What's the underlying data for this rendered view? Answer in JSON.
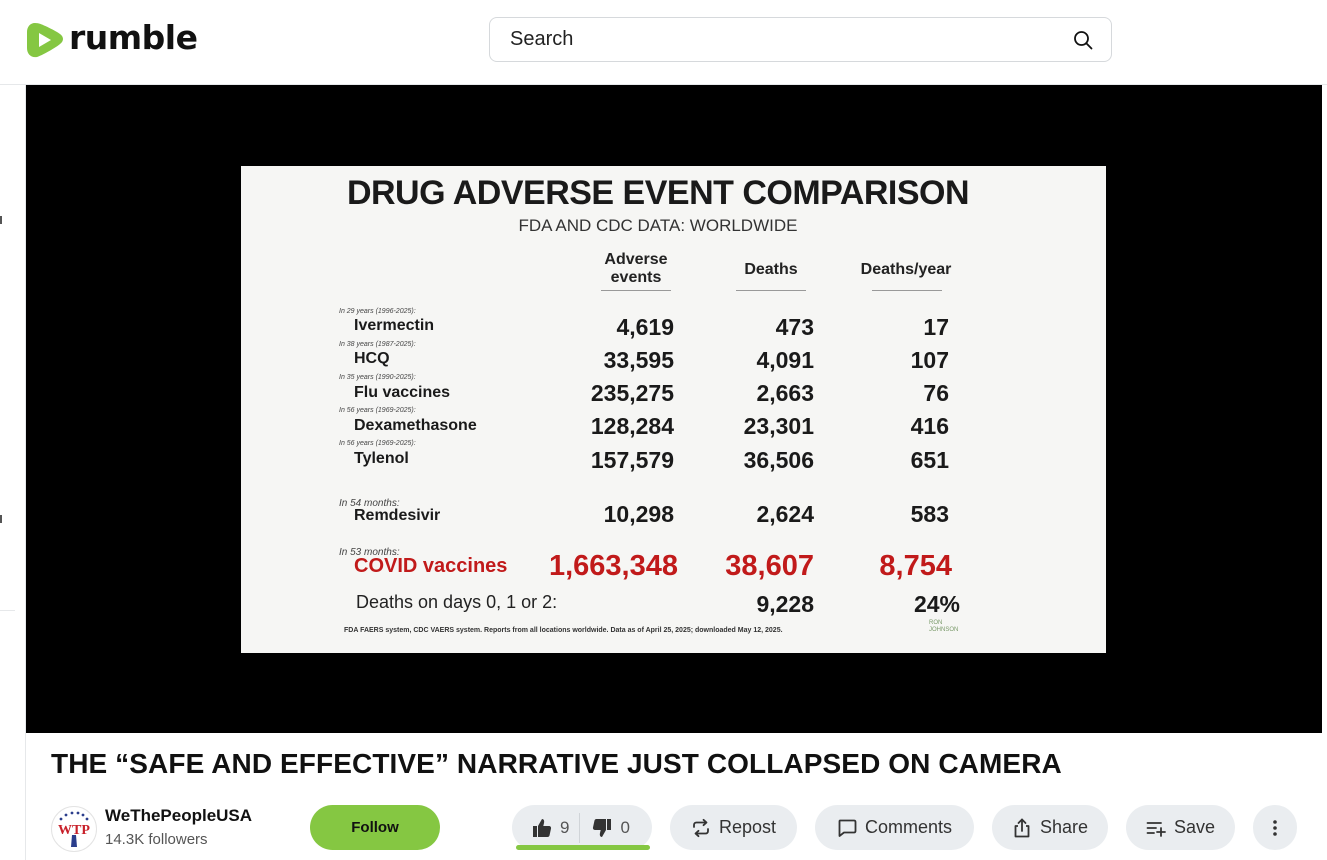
{
  "header": {
    "logo_text": "rumble",
    "search_placeholder": "Search"
  },
  "slide": {
    "title": "DRUG ADVERSE EVENT COMPARISON",
    "subtitle": "FDA AND CDC DATA: WORLDWIDE",
    "columns": [
      "Adverse events",
      "Deaths",
      "Deaths/year"
    ],
    "rows": [
      {
        "note": "In 29 years (1996-2025):",
        "drug": "Ivermectin",
        "adverse": "4,619",
        "deaths": "473",
        "per_year": "17"
      },
      {
        "note": "In 38 years (1987-2025):",
        "drug": "HCQ",
        "adverse": "33,595",
        "deaths": "4,091",
        "per_year": "107"
      },
      {
        "note": "In 35 years (1990-2025):",
        "drug": "Flu vaccines",
        "adverse": "235,275",
        "deaths": "2,663",
        "per_year": "76"
      },
      {
        "note": "In 56 years (1969-2025):",
        "drug": "Dexamethasone",
        "adverse": "128,284",
        "deaths": "23,301",
        "per_year": "416"
      },
      {
        "note": "In 56 years (1969-2025):",
        "drug": "Tylenol",
        "adverse": "157,579",
        "deaths": "36,506",
        "per_year": "651"
      },
      {
        "note": "In 54 months:",
        "drug": "Remdesivir",
        "adverse": "10,298",
        "deaths": "2,624",
        "per_year": "583"
      },
      {
        "note": "In 53 months:",
        "drug": "COVID vaccines",
        "adverse": "1,663,348",
        "deaths": "38,607",
        "per_year": "8,754"
      }
    ],
    "deaths_days_label": "Deaths on days 0, 1 or 2:",
    "deaths_days_value": "9,228",
    "deaths_days_pct": "24%",
    "source": "FDA FAERS system, CDC VAERS system. Reports from all locations worldwide. Data as of April 25, 2025; downloaded May 12, 2025.",
    "stamp": "RON JOHNSON"
  },
  "video": {
    "title": "THE “SAFE AND EFFECTIVE” NARRATIVE JUST COLLAPSED ON CAMERA"
  },
  "channel": {
    "name": "WeThePeopleUSA",
    "followers": "14.3K followers",
    "follow_label": "Follow",
    "avatar_text": "WTP"
  },
  "actions": {
    "likes": "9",
    "dislikes": "0",
    "like_fraction": 1.0,
    "repost": "Repost",
    "comments": "Comments",
    "share": "Share",
    "save": "Save"
  },
  "colors": {
    "brand_green": "#85c742",
    "slide_red": "#c11a1a"
  }
}
